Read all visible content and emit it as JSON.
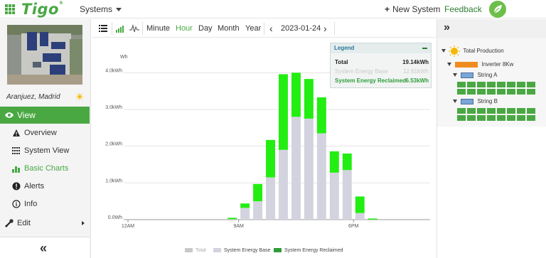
{
  "app": {
    "brand": "Tigo",
    "trademark": "®",
    "systems_label": "Systems",
    "new_system_label": "New System",
    "feedback_label": "Feedback"
  },
  "site": {
    "location": "Aranjuez, Madrid"
  },
  "nav": {
    "view": "View",
    "items": [
      {
        "label": "Overview",
        "icon": "warning-triangle-icon"
      },
      {
        "label": "System View",
        "icon": "dots-grid-icon"
      },
      {
        "label": "Basic Charts",
        "icon": "bar-chart-icon",
        "active": true
      },
      {
        "label": "Alerts",
        "icon": "alert-circle-icon"
      },
      {
        "label": "Info",
        "icon": "info-circle-icon"
      }
    ],
    "edit": "Edit",
    "collapse_label": "«"
  },
  "toolbar": {
    "ranges": [
      "Minute",
      "Hour",
      "Day",
      "Month",
      "Year"
    ],
    "active_range": "Hour",
    "date": "2023-01-24",
    "prev": "‹",
    "next": "›"
  },
  "legend": {
    "title": "Legend",
    "rows": [
      {
        "label": "Total",
        "value": "19.14kWh"
      },
      {
        "label": "System Energy Base",
        "value": "12.61kWh"
      },
      {
        "label": "System Energy Reclaimed",
        "value": "6.53kWh"
      }
    ]
  },
  "chart_data": {
    "type": "bar",
    "stacked": true,
    "ylabel": "Wh",
    "y_ticks": [
      "0.0Wh",
      "1.0kWh",
      "2.0kWh",
      "3.0kWh",
      "4.0kWh"
    ],
    "ylim": [
      0,
      4.2
    ],
    "x_tick_labels": [
      "12AM",
      "9AM",
      "6PM"
    ],
    "x_tick_hours": [
      0,
      9,
      18
    ],
    "hours": [
      8,
      9,
      10,
      11,
      12,
      13,
      14,
      15,
      16,
      17,
      18
    ],
    "series": [
      {
        "name": "System Energy Base",
        "color": "#d3d3e0",
        "values": [
          0.01,
          0.32,
          0.5,
          1.15,
          1.9,
          2.8,
          2.75,
          2.35,
          1.28,
          1.35,
          0.18
        ]
      },
      {
        "name": "System Energy Reclaimed",
        "color": "#22ee11",
        "values": [
          0.04,
          0.12,
          0.47,
          1.02,
          2.06,
          1.2,
          1.08,
          0.98,
          0.58,
          0.45,
          0.45
        ]
      }
    ],
    "tail_point": {
      "hour": 19,
      "value": 0.03
    },
    "bottom_legend": [
      "Total",
      "System Energy Base",
      "System Energy Reclaimed"
    ],
    "colors": {
      "total": "#c8c8c8",
      "base": "#d3d3e0",
      "reclaimed": "#2e9d3a"
    }
  },
  "tree": {
    "root": "Total Production",
    "inverter": "Inverter 8Kw",
    "strings": [
      {
        "name": "String A",
        "panels": 16
      },
      {
        "name": "String B",
        "panels": 16
      }
    ]
  }
}
